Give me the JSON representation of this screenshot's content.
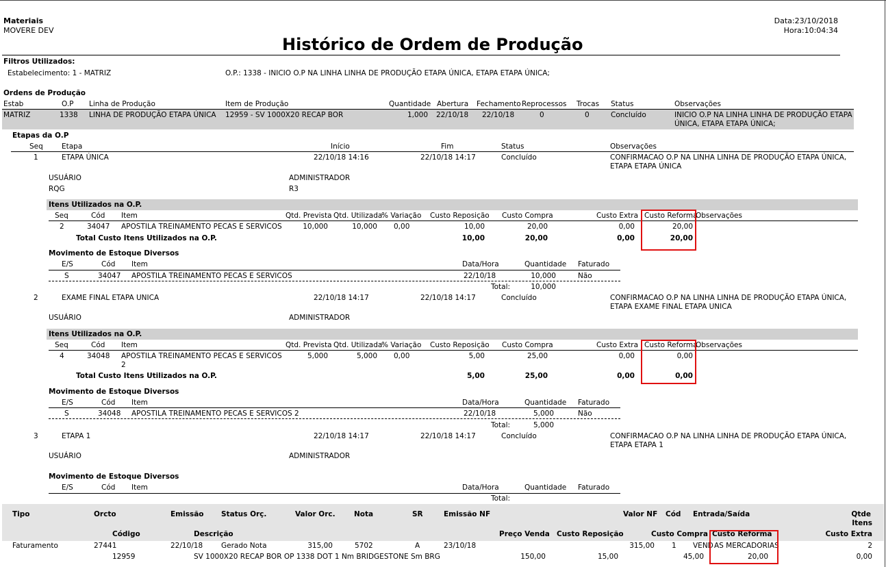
{
  "header": {
    "system": "Materiais",
    "company": "MOVERE DEV",
    "title": "Histórico de Ordem de Produção",
    "date": "Data:23/10/2018",
    "time": "Hora:10:04:34"
  },
  "filters": {
    "label": "Filtros Utilizados:",
    "estab": "Estabelecimento: 1 - MATRIZ",
    "op": "O.P.: 1338 - INICIO O.P NA LINHA LINHA DE PRODUÇÃO ETAPA ÚNICA, ETAPA ETAPA ÚNICA;"
  },
  "orders": {
    "section": "Ordens de Produção",
    "headers": {
      "estab": "Estab",
      "op": "O.P",
      "linha": "Linha de Produção",
      "item": "Item de Produção",
      "qtd": "Quantidade",
      "abertura": "Abertura",
      "fechamento": "Fechamento",
      "reprocessos": "Reprocessos",
      "trocas": "Trocas",
      "status": "Status",
      "obs": "Observações"
    },
    "row": {
      "estab": "MATRIZ",
      "op": "1338",
      "linha": "LINHA DE PRODUÇÃO ETAPA ÚNICA",
      "item": "12959 - SV 1000X20 RECAP BOR",
      "qtd": "1,000",
      "abertura": "22/10/18",
      "fechamento": "22/10/18",
      "reprocessos": "0",
      "trocas": "0",
      "status": "Concluído",
      "obs1": "INICIO O.P NA LINHA LINHA DE PRODUÇÃO ETAPA",
      "obs2": "ÚNICA, ETAPA ETAPA ÚNICA;"
    }
  },
  "stages": {
    "section": "Etapas da O.P",
    "headers": {
      "seq": "Seq",
      "etapa": "Etapa",
      "inicio": "Início",
      "fim": "Fim",
      "status": "Status",
      "obs": "Observações"
    },
    "common": {
      "usuario_label": "USUÁRIO",
      "usuario": "ADMINISTRADOR",
      "items_title": "Itens Utilizados na O.P.",
      "items_headers": {
        "seq": "Seq",
        "cod": "Cód",
        "item": "Item",
        "prev": "Qtd. Prevista",
        "util": "Qtd. Utilizada",
        "var": "% Variação",
        "rep": "Custo Reposição",
        "compra": "Custo Compra",
        "extra": "Custo Extra",
        "reforma": "Custo Reforma",
        "obs": "Observações"
      },
      "total_label": "Total Custo Itens Utilizados na O.P.",
      "mov_title": "Movimento de Estoque Diversos",
      "mov_headers": {
        "es": "E/S",
        "cod": "Cód",
        "item": "Item",
        "dh": "Data/Hora",
        "qtd": "Quantidade",
        "fat": "Faturado"
      },
      "mov_total_label": "Total:"
    },
    "s1": {
      "seq": "1",
      "etapa": "ETAPA ÚNICA",
      "inicio": "22/10/18 14:16",
      "fim": "22/10/18 14:17",
      "status": "Concluído",
      "obs1": "CONFIRMACAO O.P NA LINHA LINHA DE PRODUÇÃO ETAPA ÚNICA,",
      "obs2": "ETAPA ETAPA ÚNICA",
      "rqg_label": "RQG",
      "rqg": "R3",
      "item": {
        "seq": "2",
        "cod": "34047",
        "desc": "APOSTILA TREINAMENTO PECAS E SERVICOS",
        "prev": "10,000",
        "util": "10,000",
        "var": "0,00",
        "rep": "10,00",
        "compra": "20,00",
        "extra": "0,00",
        "reforma": "20,00"
      },
      "total": {
        "rep": "10,00",
        "compra": "20,00",
        "extra": "0,00",
        "reforma": "20,00"
      },
      "mov": {
        "es": "S",
        "cod": "34047",
        "item": "APOSTILA TREINAMENTO PECAS E SERVICOS",
        "dh": "22/10/18",
        "qtd": "10,000",
        "fat": "Não",
        "total": "10,000"
      }
    },
    "s2": {
      "seq": "2",
      "etapa": "EXAME FINAL ETAPA UNICA",
      "inicio": "22/10/18 14:17",
      "fim": "22/10/18 14:17",
      "status": "Concluído",
      "obs1": "CONFIRMACAO O.P NA LINHA LINHA DE PRODUÇÃO ETAPA ÚNICA,",
      "obs2": "ETAPA EXAME FINAL ETAPA UNICA",
      "item": {
        "seq": "4",
        "cod": "34048",
        "desc": "APOSTILA TREINAMENTO PECAS E SERVICOS",
        "desc2": "2",
        "prev": "5,000",
        "util": "5,000",
        "var": "0,00",
        "rep": "5,00",
        "compra": "25,00",
        "extra": "0,00",
        "reforma": "0,00"
      },
      "total": {
        "rep": "5,00",
        "compra": "25,00",
        "extra": "0,00",
        "reforma": "0,00"
      },
      "mov": {
        "es": "S",
        "cod": "34048",
        "item": "APOSTILA TREINAMENTO PECAS E SERVICOS 2",
        "dh": "22/10/18",
        "qtd": "5,000",
        "fat": "Não",
        "total": "5,000"
      }
    },
    "s3": {
      "seq": "3",
      "etapa": "ETAPA 1",
      "inicio": "22/10/18 14:17",
      "fim": "22/10/18 14:17",
      "status": "Concluído",
      "obs1": "CONFIRMACAO O.P NA LINHA LINHA DE PRODUÇÃO ETAPA ÚNICA,",
      "obs2": "ETAPA ETAPA 1"
    }
  },
  "billing": {
    "headers1": {
      "tipo": "Tipo",
      "orcto": "Orcto",
      "emissao": "Emissão",
      "status": "Status Orç.",
      "valor": "Valor Orc.",
      "nota": "Nota",
      "sr": "SR",
      "emissao_nf": "Emissão NF",
      "valor_nf": "Valor NF",
      "cod": "Cód",
      "es": "Entrada/Saída",
      "qtde1": "Qtde",
      "qtde2": "Itens"
    },
    "headers2": {
      "codigo": "Código",
      "descricao": "Descrição",
      "preco": "Preço Venda",
      "rep": "Custo Reposição",
      "compra": "Custo Compra",
      "reforma": "Custo Reforma",
      "extra": "Custo Extra"
    },
    "row1": {
      "tipo": "Faturamento",
      "orcto": "27441",
      "emissao": "22/10/18",
      "status": "Gerado Nota",
      "valor": "315,00",
      "nota": "5702",
      "sr": "A",
      "emissao_nf": "23/10/18",
      "valor_nf": "315,00",
      "cod": "1",
      "es_a": "VEND",
      "es_b": "AS MERCADORIAS",
      "qtde": "2"
    },
    "row2": {
      "codigo": "12959",
      "descricao": "SV 1000X20 RECAP BOR OP 1338 DOT 1 Nm BRIDGESTONE Sm BRG",
      "preco": "150,00",
      "rep": "15,00",
      "compra": "45,00",
      "reforma": "20,00",
      "extra": "0,00"
    }
  }
}
